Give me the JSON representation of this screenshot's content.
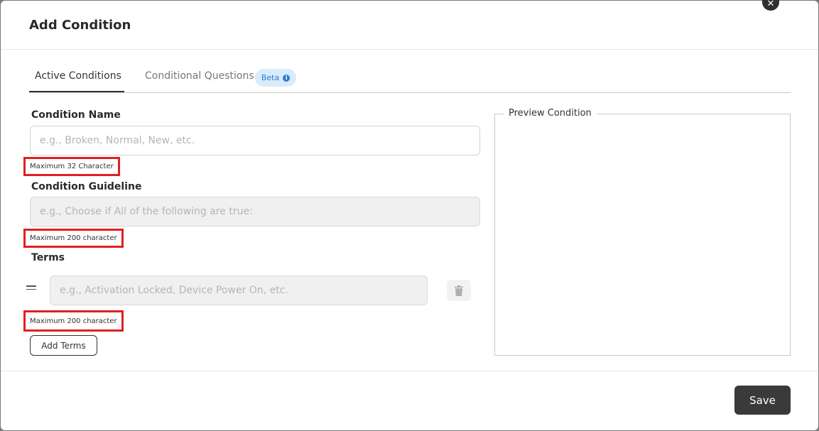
{
  "dialog": {
    "title": "Add Condition"
  },
  "tabs": [
    {
      "label": "Active Conditions",
      "active": true
    },
    {
      "label": "Conditional Questions",
      "active": false,
      "badge": "Beta"
    }
  ],
  "form": {
    "condition_name": {
      "label": "Condition Name",
      "placeholder": "e.g., Broken, Normal, New, etc.",
      "hint": "Maximum 32 Character"
    },
    "condition_guideline": {
      "label": "Condition Guideline",
      "placeholder": "e.g., Choose if All of the following are true:",
      "hint": "Maximum 200 character"
    },
    "terms": {
      "label": "Terms",
      "placeholder": "e.g., Activation Locked, Device Power On, etc.",
      "hint": "Maximum 200 character",
      "add_button": "Add Terms"
    }
  },
  "preview": {
    "legend": "Preview Condition"
  },
  "footer": {
    "save_label": "Save"
  },
  "colors": {
    "accent_dark": "#3a3a3a",
    "highlight_red": "#e02020",
    "badge_blue": "#2b7bd0"
  }
}
